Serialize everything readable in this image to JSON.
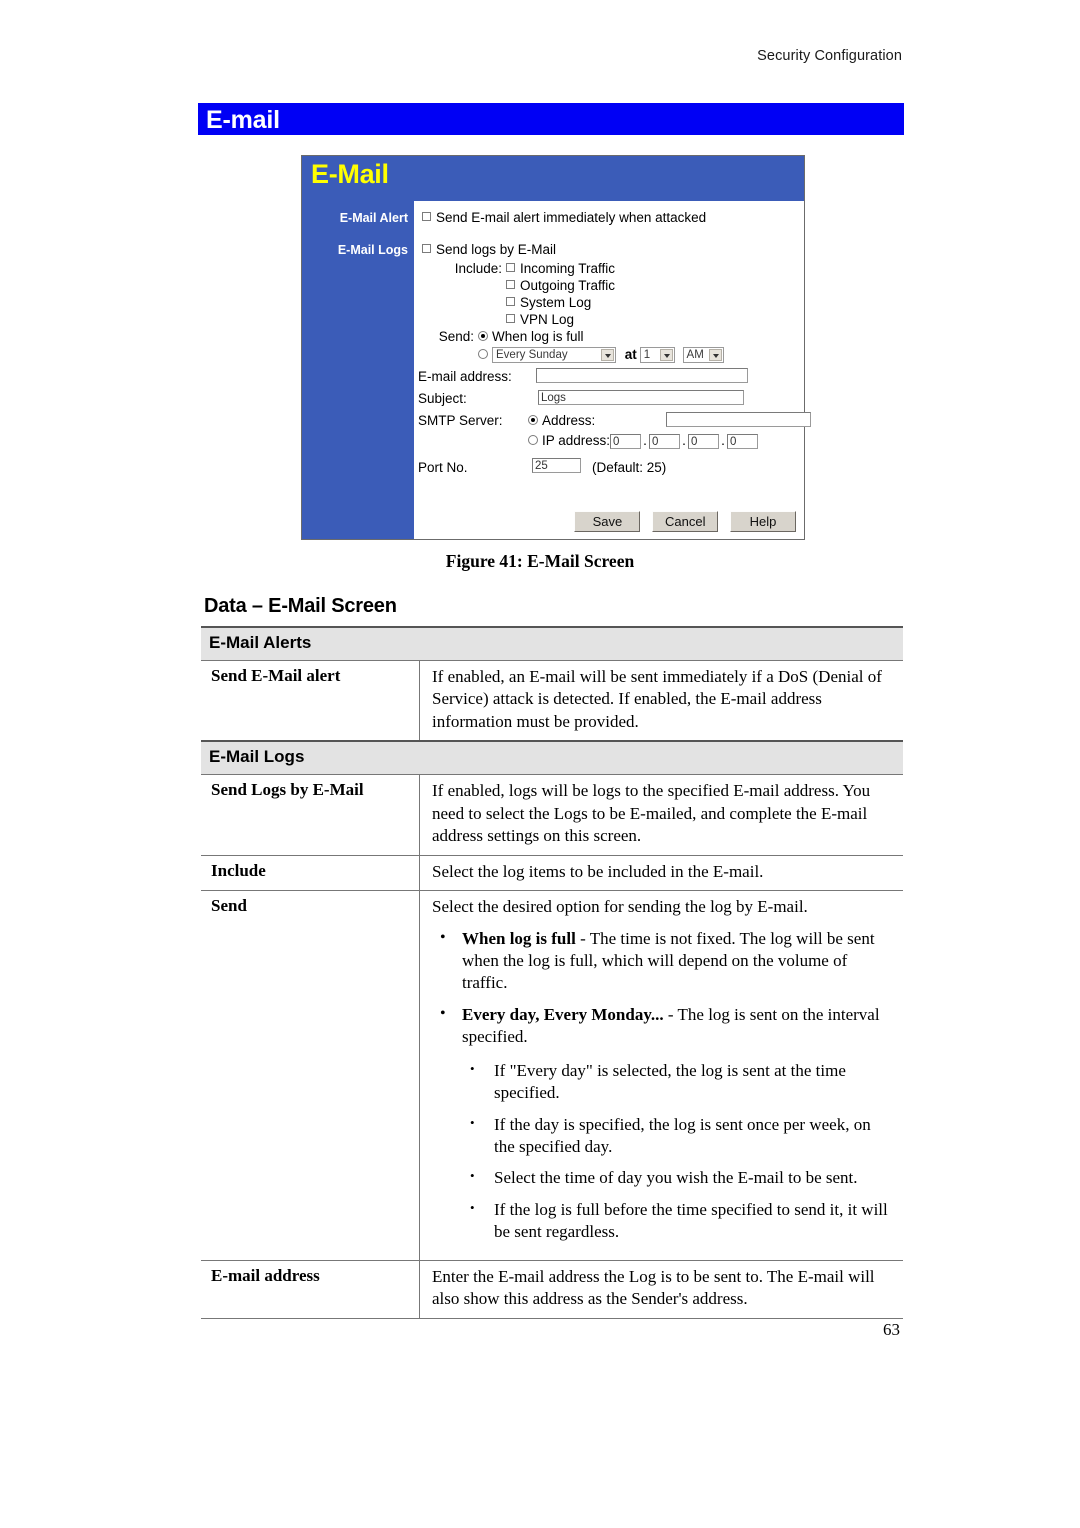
{
  "page": {
    "running_header": "Security Configuration",
    "section_heading": "E-mail",
    "figure_caption": "Figure 41: E-Mail Screen",
    "data_heading": "Data – E-Mail Screen",
    "page_number": "63"
  },
  "screenshot": {
    "title": "E-Mail",
    "sidebar": {
      "alert_label": "E-Mail Alert",
      "logs_label": "E-Mail Logs"
    },
    "alert_checkbox_label": "Send E-mail alert immediately when attacked",
    "send_logs_checkbox_label": "Send logs by E-Mail",
    "include_label": "Include:",
    "include_options": [
      "Incoming Traffic",
      "Outgoing Traffic",
      "System Log",
      "VPN Log"
    ],
    "send_label": "Send:",
    "send_when_full_label": "When log is full",
    "send_schedule_day_value": "Every Sunday",
    "send_at_label": "at",
    "send_hour_value": "1",
    "send_ampm_value": "AM",
    "email_address_label": "E-mail address:",
    "email_address_value": "",
    "subject_label": "Subject:",
    "subject_value": "Logs",
    "smtp_server_label": "SMTP Server:",
    "smtp_address_radio_label": "Address:",
    "smtp_address_value": "",
    "smtp_ip_radio_label": "IP address:",
    "smtp_ip_octets": [
      "0",
      "0",
      "0",
      "0"
    ],
    "ip_separator": ".",
    "port_label": "Port No.",
    "port_value": "25",
    "port_default_note": "(Default: 25)",
    "buttons": {
      "save": "Save",
      "cancel": "Cancel",
      "help": "Help"
    },
    "colors": {
      "title_bar": "#3b5cb8",
      "title_text": "#ffff00",
      "sidebar": "#3b5cb8"
    }
  },
  "table": {
    "sections": [
      {
        "title": "E-Mail Alerts",
        "rows": [
          {
            "key": "Send E-Mail alert",
            "value": "If enabled, an E-mail will be sent immediately if a DoS (Denial of Service) attack is detected. If enabled, the E-mail address information must be provided."
          }
        ]
      },
      {
        "title": "E-Mail Logs",
        "rows": [
          {
            "key": "Send Logs by E-Mail",
            "value": "If enabled, logs will be logs to the specified E-mail address. You need to select the Logs to be E-mailed, and complete the E-mail address settings on this screen."
          },
          {
            "key": "Include",
            "value": "Select the log items to be included in the E-mail."
          },
          {
            "key": "Send",
            "value": "Select the desired option for sending the log by E-mail.",
            "bullets": [
              {
                "bold": "When log is full",
                "text": " - The time is not fixed. The log will be sent when the log is full, which will depend on the volume of traffic."
              },
              {
                "bold": "Every day, Every Monday...",
                "text": " - The log is sent on the interval specified."
              }
            ],
            "sub_bullets": [
              "If \"Every day\" is selected, the log is sent at the time specified.",
              "If the day is specified, the log is sent once per week, on the specified day.",
              "Select the time of day you wish the E-mail to be sent.",
              "If the log is full before the time specified to send it, it will be sent regardless."
            ]
          },
          {
            "key": "E-mail address",
            "value": "Enter the E-mail address the Log is to be sent to. The E-mail will also show this address as the Sender's address."
          }
        ]
      }
    ]
  }
}
